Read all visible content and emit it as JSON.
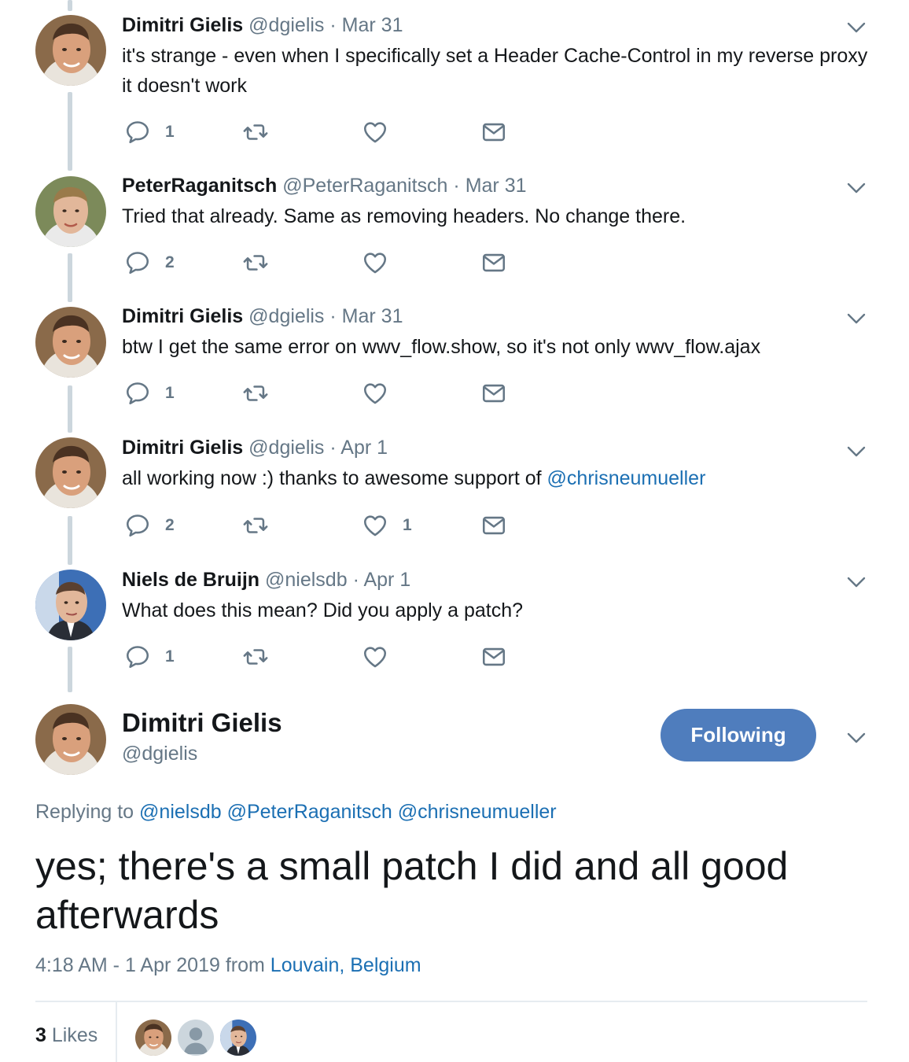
{
  "thread": [
    {
      "name": "Dimitri Gielis",
      "handle": "@dgielis",
      "time": "Mar 31",
      "text": "it's strange - even when I specifically set a Header Cache-Control in my reverse proxy it doesn't work",
      "replies": "1",
      "likes": ""
    },
    {
      "name": "PeterRaganitsch",
      "handle": "@PeterRaganitsch",
      "time": "Mar 31",
      "text": "Tried that already. Same as removing headers. No change there.",
      "replies": "2",
      "likes": ""
    },
    {
      "name": "Dimitri Gielis",
      "handle": "@dgielis",
      "time": "Mar 31",
      "text": "btw I get the same error on wwv_flow.show, so it's not only wwv_flow.ajax",
      "replies": "1",
      "likes": ""
    },
    {
      "name": "Dimitri Gielis",
      "handle": "@dgielis",
      "time": "Apr 1",
      "text_before": "all working now :) thanks to awesome support of ",
      "text_mention": "@chrisneumueller",
      "replies": "2",
      "likes": "1"
    },
    {
      "name": "Niels de Bruijn",
      "handle": "@nielsdb",
      "time": "Apr 1",
      "text": "What does this mean? Did you apply a patch?",
      "replies": "1",
      "likes": ""
    }
  ],
  "separator": "·",
  "main": {
    "name": "Dimitri Gielis",
    "handle": "@dgielis",
    "follow_label": "Following",
    "replying_prefix": "Replying to",
    "replying_to": [
      "@nielsdb",
      "@PeterRaganitsch",
      "@chrisneumueller"
    ],
    "text": "yes; there's a small patch I did and all good afterwards",
    "timestamp": "4:18 AM - 1 Apr 2019",
    "from_label": "from",
    "location": "Louvain, Belgium",
    "likes_count": "3",
    "likes_label": "Likes"
  },
  "colors": {
    "link": "#1b6fb3",
    "muted": "#657786",
    "button": "#4f7dbd",
    "thread_line": "#ccd6dd"
  },
  "icons": {
    "reply": "reply-icon",
    "retweet": "retweet-icon",
    "like": "heart-icon",
    "dm": "envelope-icon",
    "caret": "chevron-down-icon"
  }
}
